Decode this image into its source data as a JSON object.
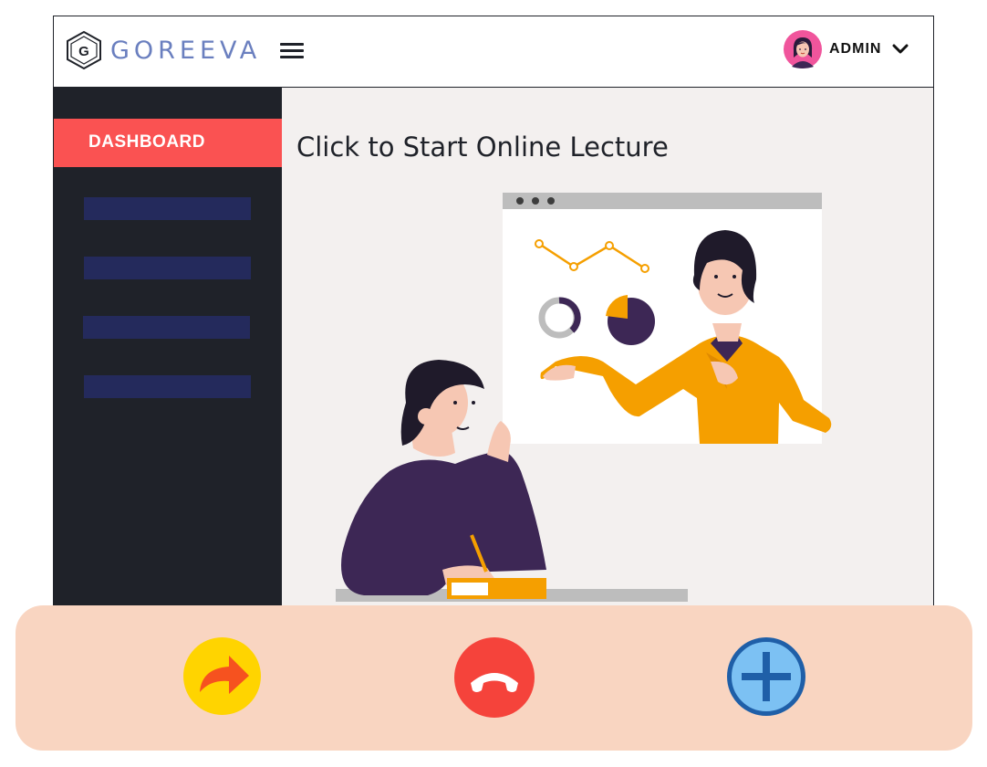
{
  "header": {
    "logo_letter": "G",
    "logo_text": "GOREEVA",
    "user_name": "ADMIN"
  },
  "sidebar": {
    "active_item": "DASHBOARD"
  },
  "main": {
    "title": "Click to Start Online Lecture"
  },
  "icons": {
    "menu": "hamburger-icon",
    "user_avatar": "avatar",
    "dropdown": "chevron-down-icon",
    "forward": "forward-arrow-icon",
    "hangup": "hang-up-phone-icon",
    "add": "plus-icon"
  },
  "colors": {
    "sidebar_bg": "#1f2229",
    "active_item": "#fa5252",
    "placeholder_item": "#242a5c",
    "main_bg": "#f3f0ef",
    "callbar_bg": "#f9d5c1",
    "forward_button": "#ffd400",
    "hangup_button": "#f5433b",
    "add_button": "#7cc1f3",
    "logo_text": "#6a7fbf"
  }
}
